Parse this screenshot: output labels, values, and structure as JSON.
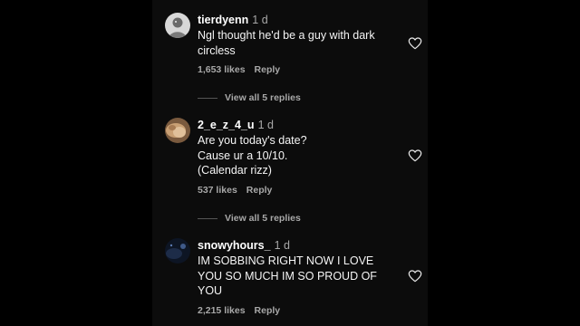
{
  "comments": [
    {
      "username": "tierdyenn",
      "time": "1 d",
      "lines": [
        "Ngl thought he'd be a guy with dark",
        "circless"
      ],
      "likes": "1,653 likes",
      "reply_label": "Reply",
      "view_replies": "View all 5 replies"
    },
    {
      "username": "2_e_z_4_u",
      "time": "1 d",
      "lines": [
        "Are you today's date?",
        "Cause ur a 10/10.",
        "(Calendar rizz)"
      ],
      "likes": "537 likes",
      "reply_label": "Reply",
      "view_replies": "View all 5 replies"
    },
    {
      "username": "snowyhours_",
      "time": "1 d",
      "lines": [
        "IM SOBBING RIGHT NOW I LOVE",
        "YOU SO MUCH IM SO PROUD OF",
        "YOU"
      ],
      "likes": "2,215 likes",
      "reply_label": "Reply"
    }
  ],
  "icons": {
    "like": "heart-outline-icon"
  },
  "colors": {
    "background": "#000000",
    "panel": "#0c0c0c",
    "text": "#ffffff",
    "secondary": "#a8a8a8"
  }
}
